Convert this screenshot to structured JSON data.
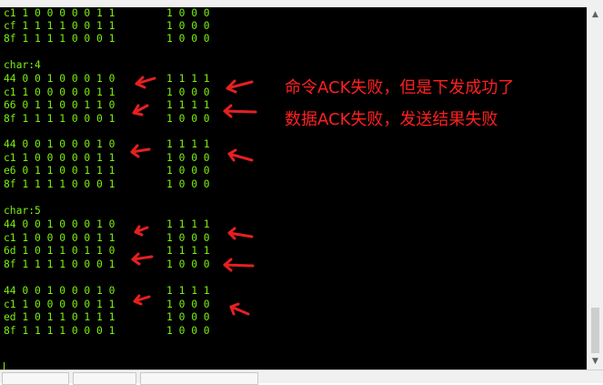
{
  "console": {
    "lines": [
      {
        "left": "c1 1 0 0 0 0 0 1 1",
        "right": "1 0 0 0"
      },
      {
        "left": "cf 1 1 1 1 0 0 1 1",
        "right": "1 0 0 0"
      },
      {
        "left": "8f 1 1 1 1 0 0 0 1",
        "right": "1 0 0 0"
      },
      {
        "left": "",
        "right": ""
      },
      {
        "left": "char:4",
        "right": ""
      },
      {
        "left": "44 0 0 1 0 0 0 1 0",
        "right": "1 1 1 1"
      },
      {
        "left": "c1 1 0 0 0 0 0 1 1",
        "right": "1 0 0 0"
      },
      {
        "left": "66 0 1 1 0 0 1 1 0",
        "right": "1 1 1 1"
      },
      {
        "left": "8f 1 1 1 1 0 0 0 1",
        "right": "1 0 0 0"
      },
      {
        "left": "",
        "right": ""
      },
      {
        "left": "44 0 0 1 0 0 0 1 0",
        "right": "1 1 1 1"
      },
      {
        "left": "c1 1 0 0 0 0 0 1 1",
        "right": "1 0 0 0"
      },
      {
        "left": "e6 0 1 1 0 0 1 1 1",
        "right": "1 0 0 0"
      },
      {
        "left": "8f 1 1 1 1 0 0 0 1",
        "right": "1 0 0 0"
      },
      {
        "left": "",
        "right": ""
      },
      {
        "left": "char:5",
        "right": ""
      },
      {
        "left": "44 0 0 1 0 0 0 1 0",
        "right": "1 1 1 1"
      },
      {
        "left": "c1 1 0 0 0 0 0 1 1",
        "right": "1 0 0 0"
      },
      {
        "left": "6d 1 0 1 1 0 1 1 0",
        "right": "1 1 1 1"
      },
      {
        "left": "8f 1 1 1 1 0 0 0 1",
        "right": "1 0 0 0"
      },
      {
        "left": "",
        "right": ""
      },
      {
        "left": "44 0 0 1 0 0 0 1 0",
        "right": "1 1 1 1"
      },
      {
        "left": "c1 1 0 0 0 0 0 1 1",
        "right": "1 0 0 0"
      },
      {
        "left": "ed 1 0 1 1 0 1 1 1",
        "right": "1 0 0 0"
      },
      {
        "left": "8f 1 1 1 1 0 0 0 1",
        "right": "1 0 0 0"
      }
    ]
  },
  "annotations": {
    "note1": "命令ACK失败，但是下发成功了",
    "note2": "数据ACK失败，发送结果失败"
  },
  "colors": {
    "console_bg": "#000000",
    "console_text": "#7cf00f",
    "annotation": "#ff2020"
  }
}
